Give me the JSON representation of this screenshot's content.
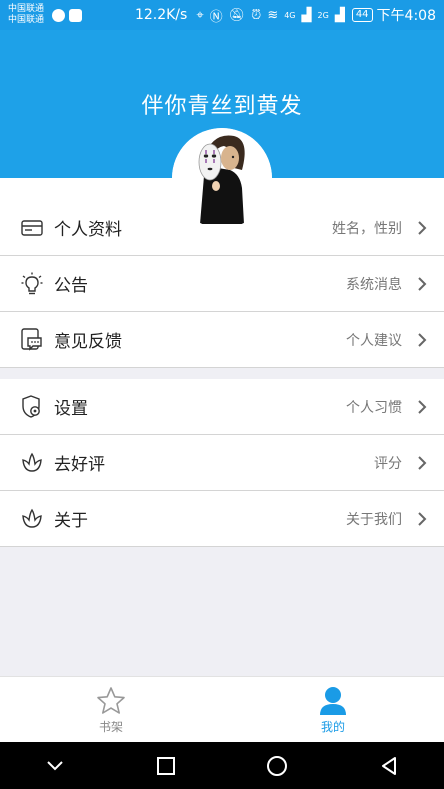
{
  "status_bar": {
    "carrier_1": "中国联通",
    "carrier_2": "中国联通",
    "speed": "12.2K/s",
    "network_4g": "4G",
    "network_2g": "2G",
    "battery": "44",
    "time": "下午4:08"
  },
  "header": {
    "slogan": "伴你青丝到黄发",
    "background_color": "#1ea1e8"
  },
  "menu": {
    "profile": {
      "label": "个人资料",
      "hint": "姓名，性别",
      "icon": "id-card-icon"
    },
    "notice": {
      "label": "公告",
      "hint": "系统消息",
      "icon": "lightbulb-icon"
    },
    "feedback": {
      "label": "意见反馈",
      "hint": "个人建议",
      "icon": "feedback-icon"
    },
    "settings": {
      "label": "设置",
      "hint": "个人习惯",
      "icon": "shield-gear-icon"
    },
    "review": {
      "label": "去好评",
      "hint": "评分",
      "icon": "flower-icon"
    },
    "about": {
      "label": "关于",
      "hint": "关于我们",
      "icon": "flower-icon"
    }
  },
  "tabbar": {
    "bookshelf": {
      "label": "书架",
      "icon": "star-icon"
    },
    "mine": {
      "label": "我的",
      "icon": "person-icon",
      "active": true
    }
  },
  "colors": {
    "accent": "#1a9be6"
  }
}
